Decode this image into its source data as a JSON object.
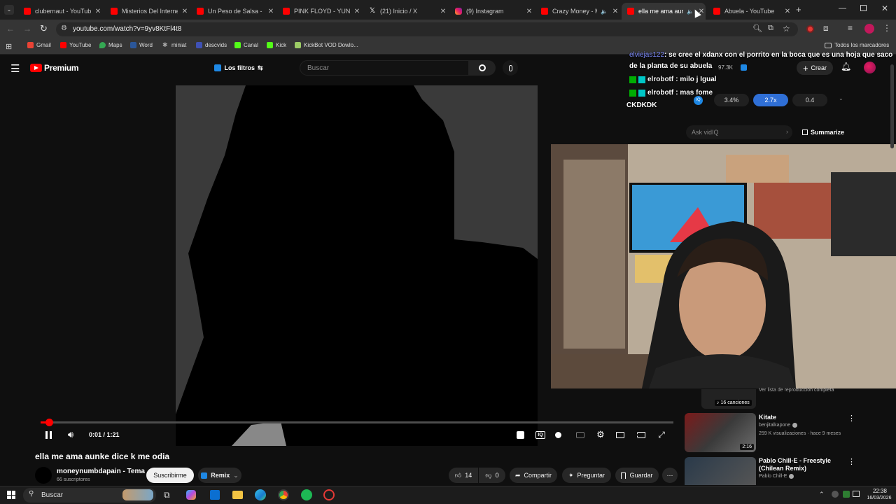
{
  "browser": {
    "tabs": [
      {
        "label": "clubernaut - YouTube",
        "icon": "youtube-icon"
      },
      {
        "label": "Misterios Del Internet",
        "icon": "youtube-icon"
      },
      {
        "label": "Un Peso de Salsa - Yo",
        "icon": "youtube-icon"
      },
      {
        "label": "PINK FLOYD - YUNG",
        "icon": "youtube-icon"
      },
      {
        "label": "(21) Inicio / X",
        "icon": "x-icon"
      },
      {
        "label": "(9) Instagram",
        "icon": "instagram-icon"
      },
      {
        "label": "Crazy Money - M",
        "icon": "youtube-icon"
      },
      {
        "label": "ella me ama aunk",
        "icon": "youtube-icon"
      },
      {
        "label": "Abuela - YouTube",
        "icon": "youtube-icon"
      }
    ],
    "url": "youtube.com/watch?v=9yv8KtFl4t8",
    "bookmarks": [
      "Gmail",
      "YouTube",
      "Maps",
      "Word",
      "miniat",
      "descvids",
      "Canal",
      "Kick",
      "KickBot VOD Dowlo..."
    ],
    "all_bookmarks": "Todos los marcadores"
  },
  "youtube": {
    "logo": "Premium",
    "filters": "Los filtros",
    "search_placeholder": "Buscar",
    "create": "Crear",
    "stats": "97.3K",
    "video_title": "ella me ama aunke dice k me odia",
    "time": "0:01 / 1:21",
    "progress": 0.013,
    "channel": "moneynumbdapain - Tema",
    "subs": "66 suscriptores",
    "subscribe": "Suscribirme",
    "remix": "Remix",
    "likes": "14",
    "dislikes": "0",
    "share": "Compartir",
    "ask": "Preguntar",
    "save": "Guardar",
    "vidiq": {
      "pct": "3.4%",
      "mult": "2.7x",
      "val": "0.4",
      "ask_placeholder": "Ask vidIQ",
      "summarize": "Summarize"
    },
    "playlist": {
      "full_list": "Ver lista de reproducción completa",
      "songs": "16 canciones"
    },
    "recommendations": [
      {
        "title": "Kitate",
        "channel": "benjitalkapone",
        "meta": "259 K visualizaciones · hace 9 meses",
        "duration": "2:16"
      },
      {
        "title": "Pablo Chill-E - Freestyle (Chilean Remix)",
        "channel": "Pablo Chill-E",
        "meta": "",
        "duration": ""
      }
    ]
  },
  "chat": [
    {
      "user": "elviejas122",
      "msg": ": se cree el xdanx con el porrito en la boca que es una hoja que saco"
    },
    {
      "user": "",
      "msg": "de la planta de su abuela"
    },
    {
      "user": "elrobotf",
      "msg": ": milo j Igual"
    },
    {
      "user": "elrobotf",
      "msg": ": mas fome"
    },
    {
      "user": "",
      "msg": "CKDKDK"
    }
  ],
  "taskbar": {
    "search": "Buscar",
    "time": "22:38",
    "date": "16/03/2026"
  }
}
